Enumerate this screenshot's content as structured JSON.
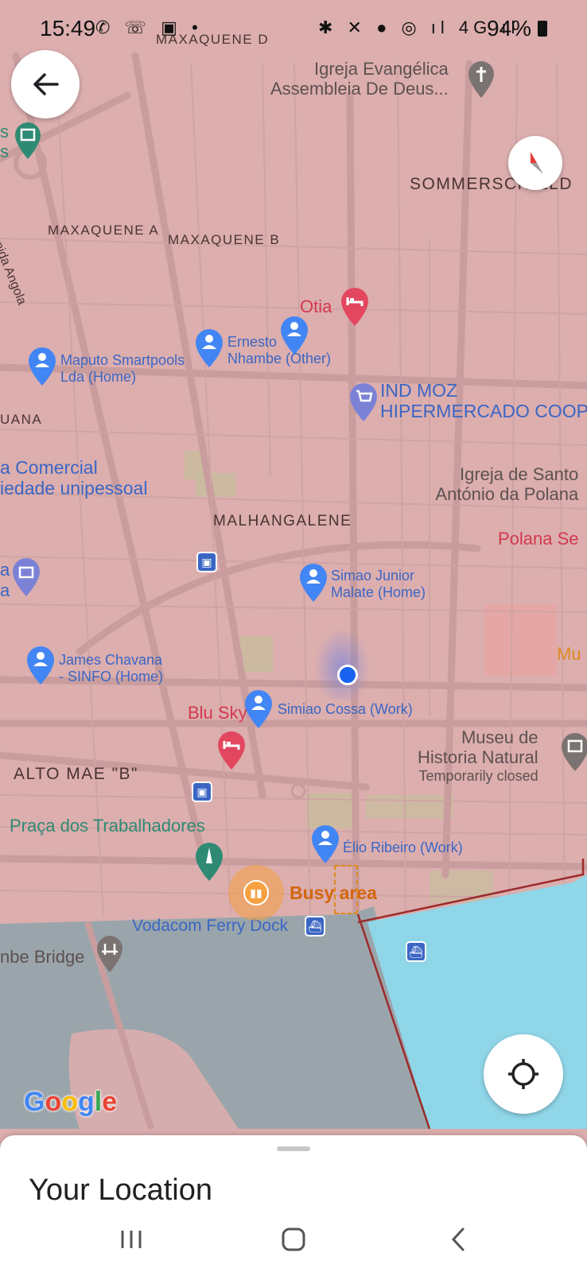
{
  "status_bar": {
    "time": "15:49",
    "battery": "94%",
    "left_icons": "✆ ☏ ▣ •",
    "right_icons": "✱ ✕ ● ◎ ıl 4G ıl"
  },
  "map": {
    "areas": {
      "maxaquene_d": "MAXAQUENE D",
      "sommerschield": "SOMMERSCHIELD",
      "maxaquene_a": "MAXAQUENE A",
      "maxaquene_b": "MAXAQUENE B",
      "uana": "UANA",
      "malhangalene": "MALHANGALENE",
      "alto_mae_b": "ALTO MAE \"B\""
    },
    "street_avenida_angola": "nida Angola",
    "pois": {
      "igreja_evangelica_1": "Igreja Evangélica",
      "igreja_evangelica_2": "Assembleia De Deus...",
      "otia": "Otia",
      "ind_moz_1": "IND MOZ",
      "ind_moz_2": "HIPERMERCADO COOP",
      "comercial_1": "a Comercial",
      "comercial_2": "iedade unipessoal",
      "igreja_santo_1": "Igreja de Santo",
      "igreja_santo_2": "António da Polana",
      "polana": "Polana Se",
      "mu": "Mu",
      "blu_sky": "Blu Sky",
      "museu_1": "Museu de",
      "museu_2": "Historia Natural",
      "museu_status": "Temporarily closed",
      "praca": "Praça dos Trabalhadores",
      "ferry": "Vodacom Ferry Dock",
      "bridge": "nbe Bridge",
      "left_s1": "s",
      "left_s2": "s",
      "left_a1": "a",
      "left_a2": "a"
    },
    "contacts": {
      "maputo_1": "Maputo Smartpools",
      "maputo_2": "Lda (Home)",
      "ernesto_1": "Ernesto",
      "ernesto_2": "Nhambe (Other)",
      "simao_1": "Simao Junior",
      "simao_2": "Malate (Home)",
      "james_1": "James Chavana",
      "james_2": "- SINFO (Home)",
      "simiao": "Simiao Cossa (Work)",
      "elio": "Élio Ribeiro (Work)"
    },
    "busy_area": "Busy area",
    "google_logo": {
      "text": "Google",
      "colors": [
        "#4285f4",
        "#ea4335",
        "#fbbc05",
        "#4285f4",
        "#34a853",
        "#ea4335"
      ]
    },
    "colors": {
      "land": "#dcaeae",
      "water_gray": "#9aa5ab",
      "water_blue": "#8fd6e8",
      "park": "#c4bf9a",
      "pin_blue": "#4285f4",
      "pin_red": "#e2475f",
      "busy_orange": "#f5a142"
    }
  },
  "controls": {
    "back_icon": "arrow-left",
    "compass_icon": "compass",
    "my_location_icon": "crosshair"
  },
  "bottom_sheet": {
    "title": "Your Location"
  },
  "nav_bar": {
    "recents_icon": "recents",
    "home_icon": "home",
    "back_icon": "back"
  }
}
